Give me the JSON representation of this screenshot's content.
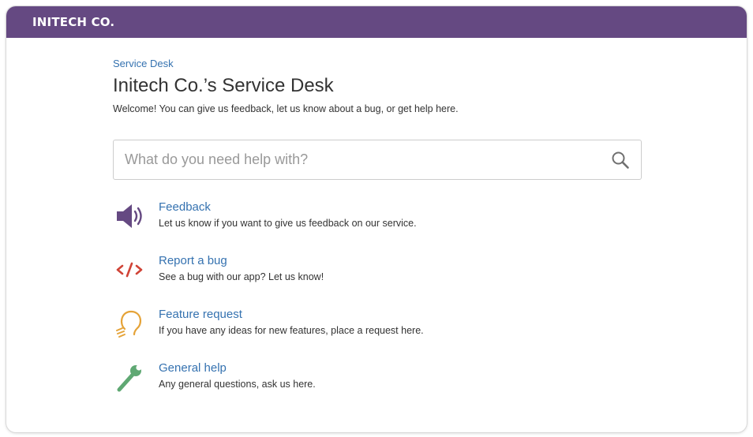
{
  "header": {
    "brand": "INITECH CO.",
    "color": "#654982"
  },
  "breadcrumb": "Service Desk",
  "title": "Initech Co.’s Service Desk",
  "welcome": "Welcome! You can give us feedback, let us know about a bug, or get help here.",
  "search": {
    "placeholder": "What do you need help with?",
    "value": "",
    "icon": "search-icon"
  },
  "request_types": [
    {
      "label": "Feedback",
      "description": "Let us know if you want to give us feedback on our service.",
      "icon": "megaphone-icon",
      "color": "#654982"
    },
    {
      "label": "Report a bug",
      "description": "See a bug with our app? Let us know!",
      "icon": "code-icon",
      "color": "#d04437"
    },
    {
      "label": "Feature request",
      "description": "If you have any ideas for new features, place a request here.",
      "icon": "lightbulb-icon",
      "color": "#e5a338"
    },
    {
      "label": "General help",
      "description": "Any general questions, ask us here.",
      "icon": "wrench-icon",
      "color": "#5fa873"
    }
  ]
}
